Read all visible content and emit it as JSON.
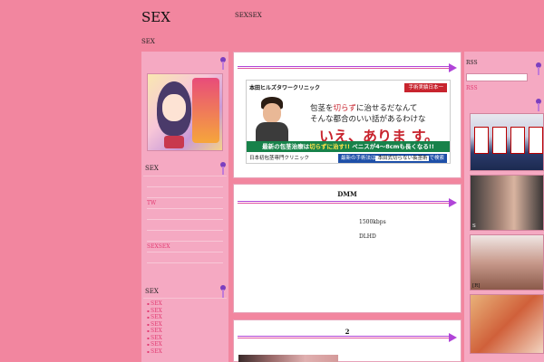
{
  "header": {
    "site_title": "SEX",
    "site_desc": "SEXSEX",
    "breadcrumb": "SEX"
  },
  "left_sidebar": {
    "heading_1": "SEX",
    "list_1": [
      "　",
      "　",
      "TW",
      "　",
      "　",
      "　",
      "SEXSEX",
      "　"
    ],
    "heading_2": "SEX",
    "list_2": [
      "SEX",
      "SEX",
      "SEX",
      "SEX",
      "SEX",
      "SEX",
      "SEX",
      "SEX"
    ]
  },
  "center": {
    "ad": {
      "clinic_name": "本田ヒルズタワークリニック",
      "badge": "手術実績日本一",
      "line1_pre": "包茎を",
      "line1_red": "切らず",
      "line1_post": "に治せるだなんて",
      "line2": "そんな都合のいい話があるわけな",
      "big": "いえ、ありま す。",
      "strip1_pre": "最新の包茎治療は",
      "strip1_mid": "切らずに治す!!",
      "strip1_post": " ペニスが4〜8cmも長くなる!!",
      "strip2_left": "日本初包茎専門クリニック",
      "strip2_mid_pre": "最新の手術法は",
      "strip2_keyword": "本田式切らない長茎術",
      "strip2_mid_post": "で検索"
    },
    "panel2": {
      "title": "DMM",
      "text1": "1500kbps",
      "text2": "DLHD"
    },
    "panel3": {
      "title": "2"
    }
  },
  "right_sidebar": {
    "rss_heading": "RSS",
    "rss_link": "RSS",
    "thumb_captions": [
      "",
      "S",
      "[R]",
      ""
    ]
  },
  "colors": {
    "background": "#f2869f",
    "sidebar": "#f5a9c2",
    "link": "#e23b72",
    "arrow": "#b044d8"
  }
}
